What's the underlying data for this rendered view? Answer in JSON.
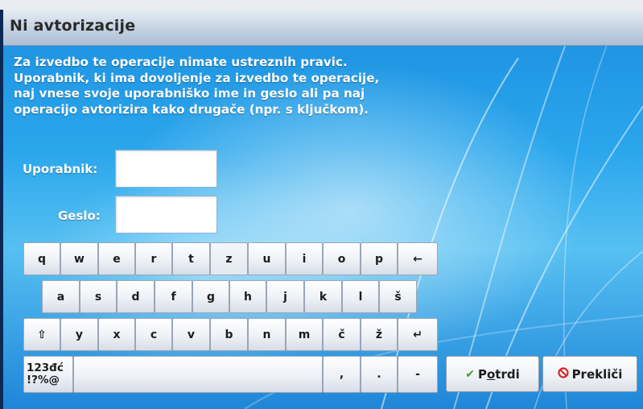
{
  "window": {
    "title": "Ni avtorizacije"
  },
  "message": "Za izvedbo te operacije nimate ustreznih pravic.\nUporabnik, ki ima dovoljenje za izvedbo te operacije,\nnaj vnese svoje uporabniško ime in geslo ali pa naj\noperacijo avtorizira kako drugače (npr. s ključkom).",
  "form": {
    "username_label": "Uporabnik:",
    "username_value": "",
    "password_label": "Geslo:",
    "password_value": ""
  },
  "keyboard": {
    "row1": [
      "q",
      "w",
      "e",
      "r",
      "t",
      "z",
      "u",
      "i",
      "o",
      "p",
      "←"
    ],
    "row2": [
      "a",
      "s",
      "d",
      "f",
      "g",
      "h",
      "j",
      "k",
      "l",
      "š"
    ],
    "row3": [
      "⇧",
      "y",
      "x",
      "c",
      "v",
      "b",
      "n",
      "m",
      "č",
      "ž",
      "↵"
    ],
    "special_line1": "123đć",
    "special_line2": "!?%@",
    "comma": ",",
    "period": ".",
    "dash": "-"
  },
  "buttons": {
    "confirm_icon": "checkmark-icon",
    "confirm_pre": "P",
    "confirm_underlined": "o",
    "confirm_post": "trdi",
    "cancel_icon": "no-entry-icon",
    "cancel_label": "Prekliči"
  },
  "colors": {
    "confirm_icon": "#3aa52b",
    "cancel_icon": "#d8262a"
  }
}
